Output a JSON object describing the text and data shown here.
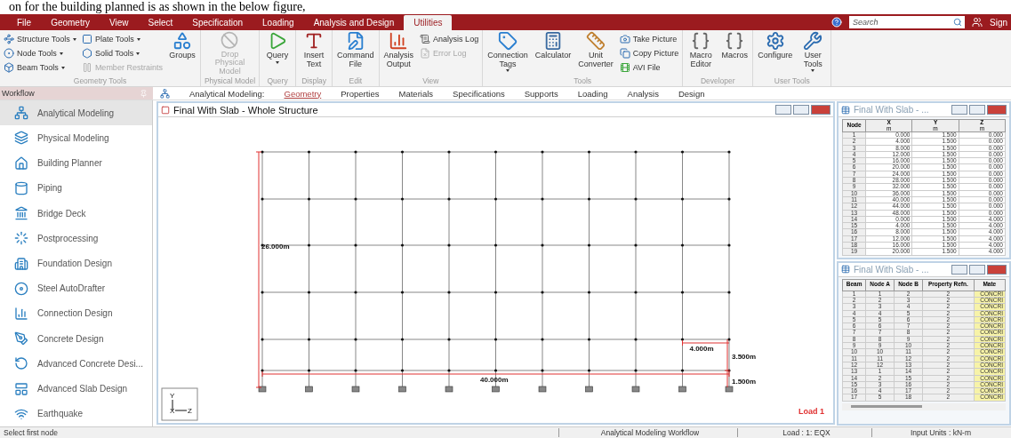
{
  "document_caption": "on for the building planned is as shown in the below figure,",
  "menu": {
    "tabs": [
      {
        "label": "File",
        "selected": false
      },
      {
        "label": "Geometry",
        "selected": false
      },
      {
        "label": "View",
        "selected": false
      },
      {
        "label": "Select",
        "selected": false
      },
      {
        "label": "Specification",
        "selected": false
      },
      {
        "label": "Loading",
        "selected": false
      },
      {
        "label": "Analysis and Design",
        "selected": false
      },
      {
        "label": "Utilities",
        "selected": true
      }
    ],
    "search": {
      "placeholder": "Search"
    },
    "account": "Sign"
  },
  "ribbon": {
    "groups": [
      {
        "label": "Geometry Tools",
        "items": [
          {
            "label": "Structure Tools",
            "kind": "small",
            "dropdown": true,
            "disabled": false
          },
          {
            "label": "Node Tools",
            "kind": "small",
            "dropdown": true,
            "disabled": false
          },
          {
            "label": "Beam Tools",
            "kind": "small",
            "dropdown": true,
            "disabled": false
          },
          {
            "label": "Plate Tools",
            "kind": "small",
            "dropdown": true,
            "disabled": false
          },
          {
            "label": "Solid Tools",
            "kind": "small",
            "dropdown": true,
            "disabled": false
          },
          {
            "label": "Member Restraints",
            "kind": "small",
            "dropdown": false,
            "disabled": true
          },
          {
            "label": "Groups",
            "kind": "large",
            "dropdown": false,
            "disabled": false
          }
        ]
      },
      {
        "label": "Physical Model",
        "items": [
          {
            "label": "Drop Physical Model",
            "kind": "large",
            "dropdown": false,
            "disabled": true
          }
        ]
      },
      {
        "label": "Query",
        "items": [
          {
            "label": "Query",
            "kind": "large",
            "dropdown": true,
            "disabled": false
          }
        ]
      },
      {
        "label": "Display",
        "items": [
          {
            "label": "Insert Text",
            "kind": "large",
            "dropdown": false,
            "disabled": false
          }
        ]
      },
      {
        "label": "Edit",
        "items": [
          {
            "label": "Command File",
            "kind": "large",
            "dropdown": false,
            "disabled": false
          }
        ]
      },
      {
        "label": "View",
        "items": [
          {
            "label": "Analysis Output",
            "kind": "large",
            "dropdown": false,
            "disabled": false
          },
          {
            "label": "Analysis Log",
            "kind": "small",
            "dropdown": false,
            "disabled": false
          },
          {
            "label": "Error Log",
            "kind": "small",
            "dropdown": false,
            "disabled": true
          }
        ]
      },
      {
        "label": "Tools",
        "items": [
          {
            "label": "Connection Tags",
            "kind": "large",
            "dropdown": true,
            "disabled": false
          },
          {
            "label": "Calculator",
            "kind": "large",
            "dropdown": false,
            "disabled": false
          },
          {
            "label": "Unit Converter",
            "kind": "large",
            "dropdown": false,
            "disabled": false
          },
          {
            "label": "Take Picture",
            "kind": "small",
            "dropdown": false,
            "disabled": false
          },
          {
            "label": "Copy Picture",
            "kind": "small",
            "dropdown": false,
            "disabled": false
          },
          {
            "label": "AVI File",
            "kind": "small",
            "dropdown": false,
            "disabled": false
          }
        ]
      },
      {
        "label": "Developer",
        "items": [
          {
            "label": "Macro Editor",
            "kind": "large",
            "dropdown": false,
            "disabled": false
          },
          {
            "label": "Macros",
            "kind": "large",
            "dropdown": false,
            "disabled": false
          }
        ]
      },
      {
        "label": "User Tools",
        "items": [
          {
            "label": "Configure",
            "kind": "large",
            "dropdown": false,
            "disabled": false
          },
          {
            "label": "User Tools",
            "kind": "large",
            "dropdown": true,
            "disabled": false
          }
        ]
      }
    ]
  },
  "workflow": {
    "title": "Workflow",
    "items": [
      {
        "label": "Analytical Modeling",
        "selected": true
      },
      {
        "label": "Physical Modeling",
        "selected": false
      },
      {
        "label": "Building Planner",
        "selected": false
      },
      {
        "label": "Piping",
        "selected": false
      },
      {
        "label": "Bridge Deck",
        "selected": false
      },
      {
        "label": "Postprocessing",
        "selected": false
      },
      {
        "label": "Foundation Design",
        "selected": false
      },
      {
        "label": "Steel AutoDrafter",
        "selected": false
      },
      {
        "label": "Connection Design",
        "selected": false
      },
      {
        "label": "Concrete Design",
        "selected": false
      },
      {
        "label": "Advanced Concrete Desi...",
        "selected": false
      },
      {
        "label": "Advanced Slab Design",
        "selected": false
      },
      {
        "label": "Earthquake",
        "selected": false
      }
    ]
  },
  "page_tabs": {
    "label": "Analytical Modeling:",
    "tabs": [
      {
        "label": "Geometry",
        "selected": true
      },
      {
        "label": "Properties",
        "selected": false
      },
      {
        "label": "Materials",
        "selected": false
      },
      {
        "label": "Specifications",
        "selected": false
      },
      {
        "label": "Supports",
        "selected": false
      },
      {
        "label": "Loading",
        "selected": false
      },
      {
        "label": "Analysis",
        "selected": false
      },
      {
        "label": "Design",
        "selected": false
      }
    ]
  },
  "structure_window": {
    "title": "Final With Slab - Whole Structure",
    "dimensions": {
      "height": "26.000m",
      "width": "40.000m",
      "bay": "4.000m",
      "storey": "3.500m",
      "plinth": "1.500m"
    },
    "load_label": "Load 1",
    "axes": {
      "vertical": "Y",
      "origin": "X",
      "horizontal": "Z"
    }
  },
  "node_table": {
    "title": "Final With Slab - ...",
    "columns": [
      {
        "label": "Node"
      },
      {
        "label": "X",
        "unit": "m"
      },
      {
        "label": "Y",
        "unit": "m"
      },
      {
        "label": "Z",
        "unit": "m"
      }
    ],
    "rows": [
      [
        "1",
        "0.000",
        "1.500",
        "0.000"
      ],
      [
        "2",
        "4.000",
        "1.500",
        "0.000"
      ],
      [
        "3",
        "8.000",
        "1.500",
        "0.000"
      ],
      [
        "4",
        "12.000",
        "1.500",
        "0.000"
      ],
      [
        "5",
        "16.000",
        "1.500",
        "0.000"
      ],
      [
        "6",
        "20.000",
        "1.500",
        "0.000"
      ],
      [
        "7",
        "24.000",
        "1.500",
        "0.000"
      ],
      [
        "8",
        "28.000",
        "1.500",
        "0.000"
      ],
      [
        "9",
        "32.000",
        "1.500",
        "0.000"
      ],
      [
        "10",
        "36.000",
        "1.500",
        "0.000"
      ],
      [
        "11",
        "40.000",
        "1.500",
        "0.000"
      ],
      [
        "12",
        "44.000",
        "1.500",
        "0.000"
      ],
      [
        "13",
        "48.000",
        "1.500",
        "0.000"
      ],
      [
        "14",
        "0.000",
        "1.500",
        "4.000"
      ],
      [
        "15",
        "4.000",
        "1.500",
        "4.000"
      ],
      [
        "16",
        "8.000",
        "1.500",
        "4.000"
      ],
      [
        "17",
        "12.000",
        "1.500",
        "4.000"
      ],
      [
        "18",
        "16.000",
        "1.500",
        "4.000"
      ],
      [
        "19",
        "20.000",
        "1.500",
        "4.000"
      ]
    ]
  },
  "beam_table": {
    "title": "Final With Slab - ...",
    "columns": [
      {
        "label": "Beam"
      },
      {
        "label": "Node A"
      },
      {
        "label": "Node B"
      },
      {
        "label": "Property Refn."
      },
      {
        "label": "Mate"
      }
    ],
    "rows": [
      [
        "1",
        "1",
        "2",
        "2",
        "CONCRI"
      ],
      [
        "2",
        "2",
        "3",
        "2",
        "CONCRI"
      ],
      [
        "3",
        "3",
        "4",
        "2",
        "CONCRI"
      ],
      [
        "4",
        "4",
        "5",
        "2",
        "CONCRI"
      ],
      [
        "5",
        "5",
        "6",
        "2",
        "CONCRI"
      ],
      [
        "6",
        "6",
        "7",
        "2",
        "CONCRI"
      ],
      [
        "7",
        "7",
        "8",
        "2",
        "CONCRI"
      ],
      [
        "8",
        "8",
        "9",
        "2",
        "CONCRI"
      ],
      [
        "9",
        "9",
        "10",
        "2",
        "CONCRI"
      ],
      [
        "10",
        "10",
        "11",
        "2",
        "CONCRI"
      ],
      [
        "11",
        "11",
        "12",
        "2",
        "CONCRI"
      ],
      [
        "12",
        "12",
        "13",
        "2",
        "CONCRI"
      ],
      [
        "13",
        "1",
        "14",
        "2",
        "CONCRI"
      ],
      [
        "14",
        "2",
        "15",
        "2",
        "CONCRI"
      ],
      [
        "15",
        "3",
        "16",
        "2",
        "CONCRI"
      ],
      [
        "16",
        "4",
        "17",
        "2",
        "CONCRI"
      ],
      [
        "17",
        "5",
        "18",
        "2",
        "CONCRI"
      ]
    ]
  },
  "status_bar": [
    "Select first node",
    "Analytical Modeling Workflow",
    "Load : 1: EQX",
    "Input Units : kN-m"
  ]
}
